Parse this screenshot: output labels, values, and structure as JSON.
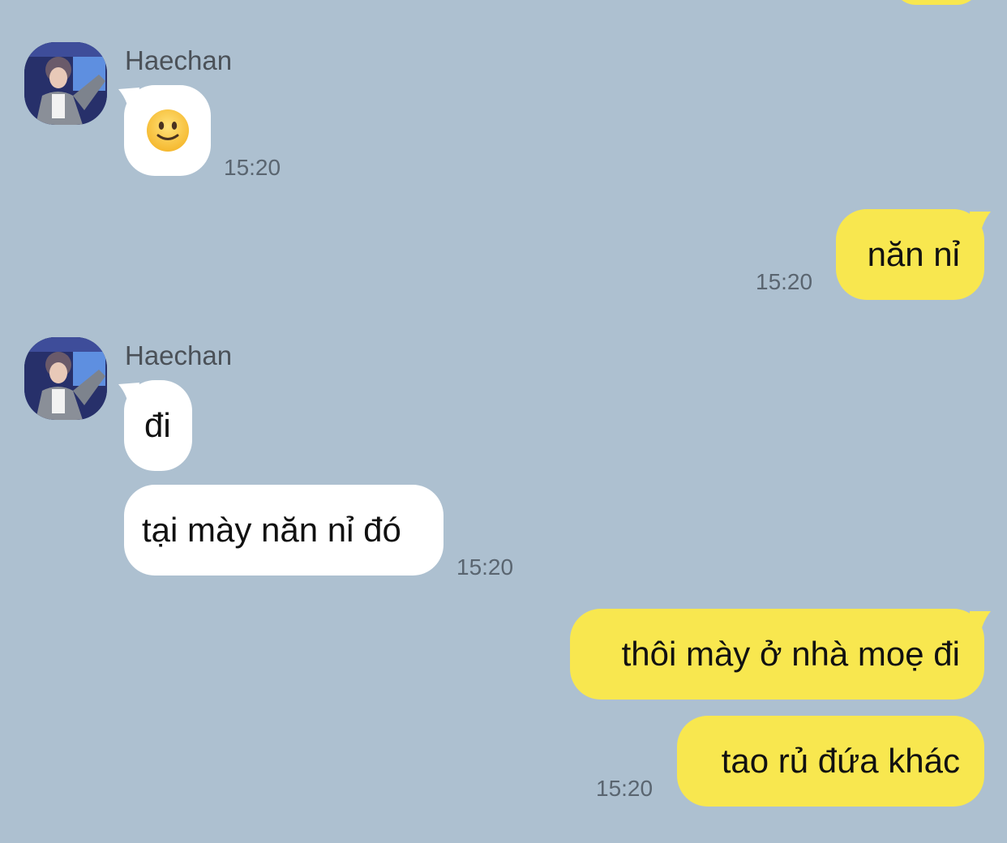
{
  "chat": {
    "sender_name": "Haechan",
    "colors": {
      "background": "#adc0d0",
      "incoming": "#ffffff",
      "outgoing": "#f8e74f"
    },
    "messages": [
      {
        "side": "in",
        "sender": "Haechan",
        "content": "slightly-smiling-face-emoji",
        "time": "15:20"
      },
      {
        "side": "out",
        "text": "năn nỉ",
        "time": "15:20"
      },
      {
        "side": "in",
        "sender": "Haechan",
        "text": "đi",
        "time": ""
      },
      {
        "side": "in",
        "text": "tại mày năn nỉ đó",
        "time": "15:20"
      },
      {
        "side": "out",
        "text": "thôi mày ở nhà moẹ đi",
        "time": ""
      },
      {
        "side": "out",
        "text": "tao rủ đứa khác",
        "time": "15:20"
      }
    ]
  }
}
